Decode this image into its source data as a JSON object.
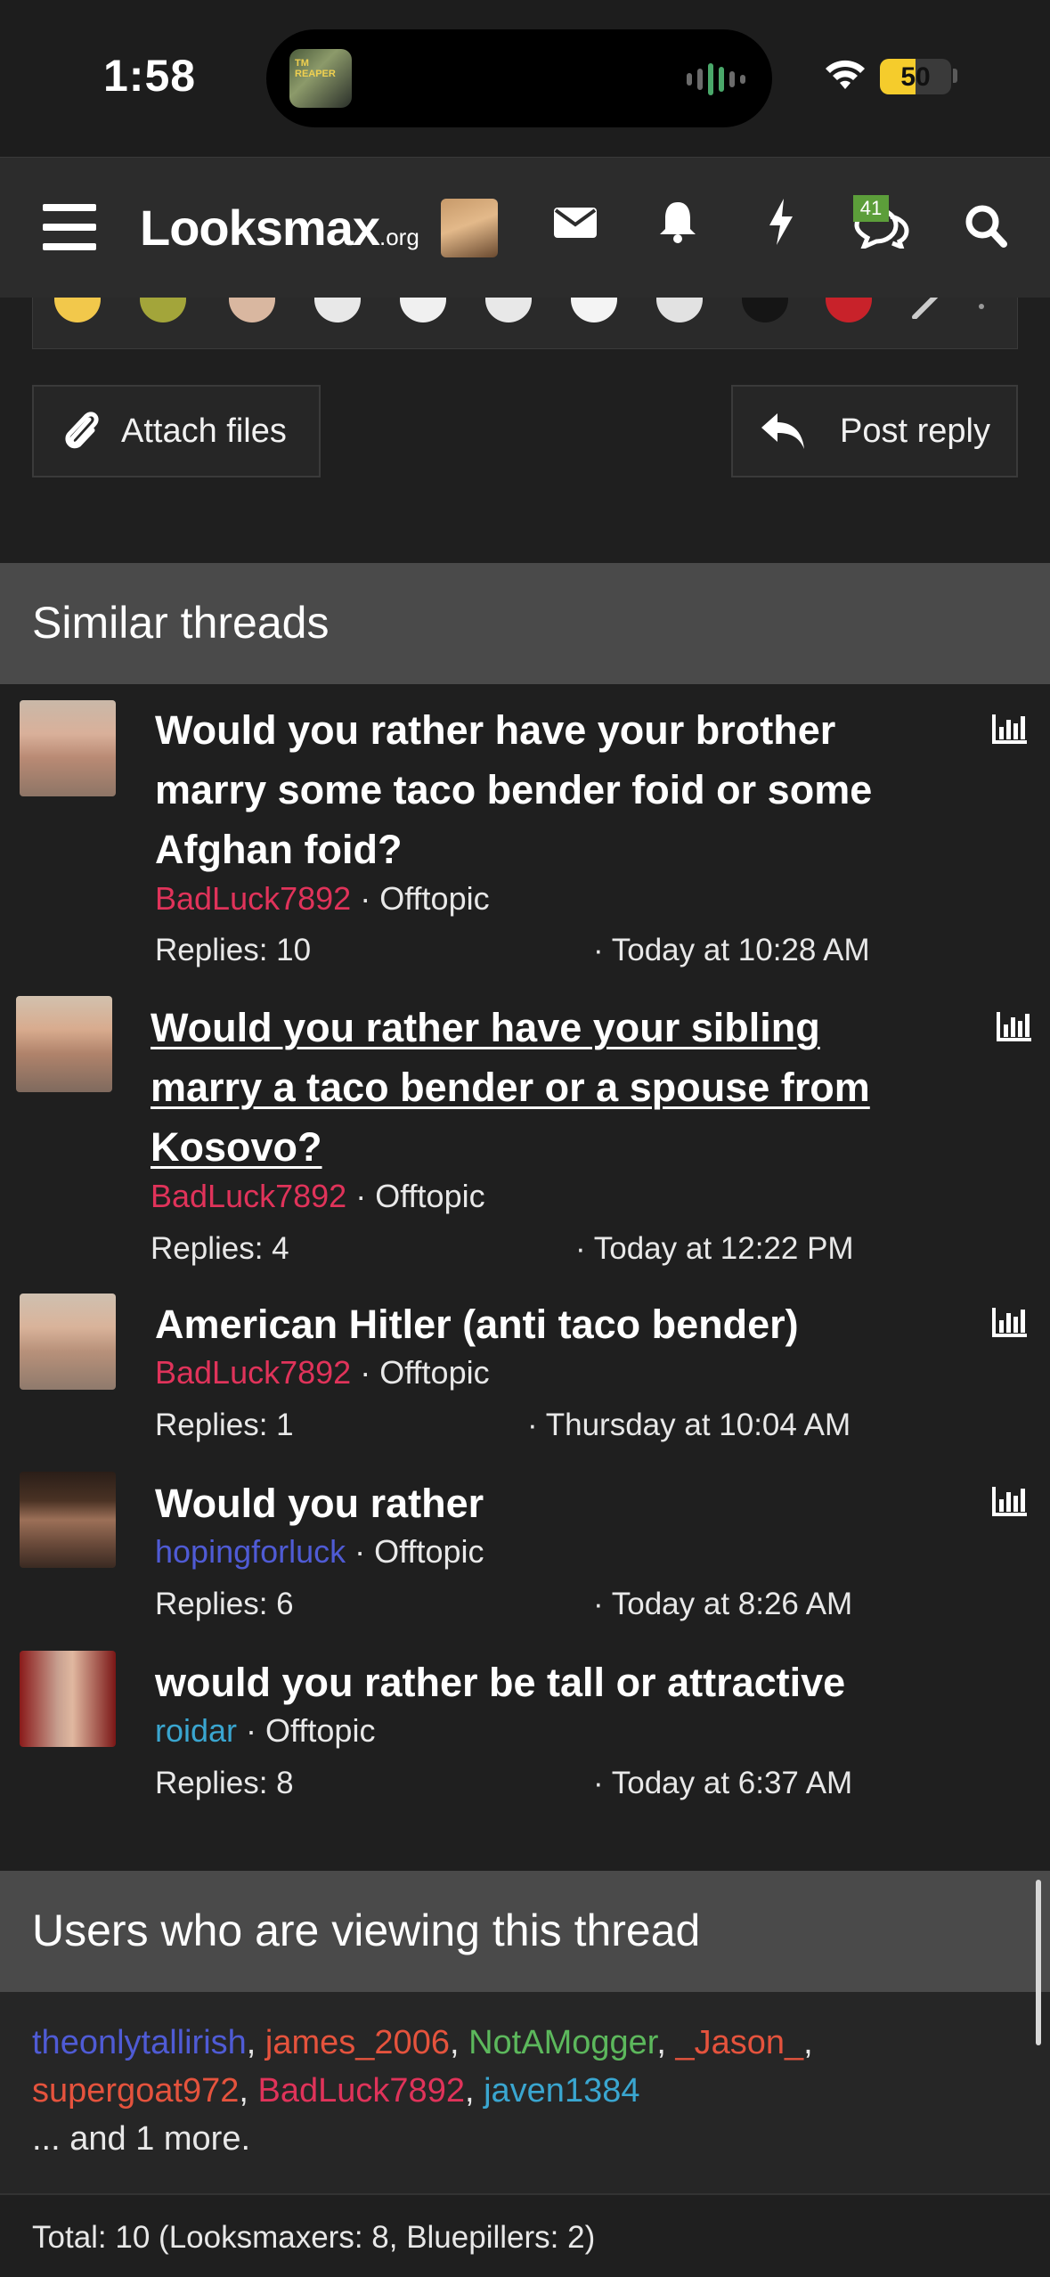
{
  "status_bar": {
    "time": "1:58",
    "island_art_text": "TM REAPER",
    "battery_percent": "50",
    "battery_level": 0.5
  },
  "header": {
    "logo_main": "Looksmax",
    "logo_suffix": ".org",
    "conversations_badge": "41",
    "icons": [
      "menu-icon",
      "avatar",
      "mail-icon",
      "bell-icon",
      "bolt-icon",
      "chat-icon",
      "search-icon"
    ]
  },
  "actions": {
    "attach_label": "Attach files",
    "reply_label": "Post reply"
  },
  "similar_threads": {
    "heading": "Similar threads",
    "items": [
      {
        "title_lines": [
          "Would you rather have your brother",
          "marry some taco bender foid or some",
          "Afghan foid?"
        ],
        "author": "BadLuck7892",
        "author_color": "#e0335a",
        "forum": "Offtopic",
        "replies": "Replies: 10",
        "date": "· Today at 10:28 AM",
        "visited": false
      },
      {
        "title_lines": [
          "Would you rather have your sibling",
          "marry a taco bender or a spouse from",
          "Kosovo?"
        ],
        "author": "BadLuck7892",
        "author_color": "#e0335a",
        "forum": "Offtopic",
        "replies": "Replies: 4",
        "date": "· Today at 12:22 PM",
        "visited": true
      },
      {
        "title_lines": [
          "American Hitler (anti taco bender)"
        ],
        "author": "BadLuck7892",
        "author_color": "#e0335a",
        "forum": "Offtopic",
        "replies": "Replies: 1",
        "date": "· Thursday at 10:04 AM",
        "visited": false
      },
      {
        "title_lines": [
          "Would you rather"
        ],
        "author": "hopingforluck",
        "author_color": "#4f5bd5",
        "forum": "Offtopic",
        "replies": "Replies: 6",
        "date": "· Today at 8:26 AM",
        "visited": false
      },
      {
        "title_lines": [
          "would you rather be tall or attractive"
        ],
        "author": "roidar",
        "author_color": "#3aa6d0",
        "forum": "Offtopic",
        "replies": "Replies: 8",
        "date": "· Today at 6:37 AM",
        "visited": false
      }
    ]
  },
  "viewers": {
    "heading": "Users who are viewing this thread",
    "users": [
      {
        "name": "theonlytallirish",
        "color": "#4f5bd5"
      },
      {
        "name": "james_2006",
        "color": "#e5533d"
      },
      {
        "name": "NotAMogger",
        "color": "#5cb85c"
      },
      {
        "name": "_Jason_",
        "color": "#e5533d"
      },
      {
        "name": "supergoat972",
        "color": "#e5533d"
      },
      {
        "name": "BadLuck7892",
        "color": "#e0335a"
      },
      {
        "name": "javen1384",
        "color": "#3aa6d0"
      }
    ],
    "separator": ", ",
    "more": "... and 1 more.",
    "total": "Total: 10 (Looksmaxers: 8, Bluepillers: 2)"
  },
  "colors": {
    "background": "#1f1f1f",
    "header_bg": "#2c2c2c",
    "section_bg": "#4a4a4a",
    "battery": "#f5cc2c",
    "badge": "#5c9e3a"
  }
}
